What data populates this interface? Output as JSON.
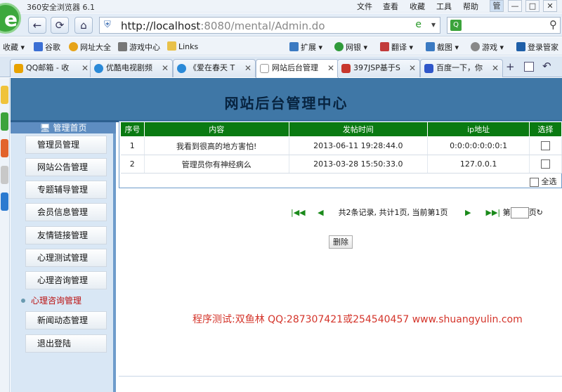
{
  "browser": {
    "title": "360安全浏览器 6.1",
    "menu": [
      "文件",
      "查看",
      "收藏",
      "工具",
      "帮助"
    ],
    "url_host": "http://localhost",
    "url_rest": ":8080/mental/Admin.do",
    "favbar": [
      "收藏",
      "谷歌",
      "网址大全",
      "游戏中心",
      "Links"
    ],
    "toolbar_right": [
      "扩展",
      "网银",
      "翻译",
      "截图",
      "游戏",
      "登录管家"
    ],
    "tabs": [
      "QQ邮箱 - 收",
      "优酷电视剧频",
      "《爱在春天 T",
      "网站后台管理",
      "397JSP基于S",
      "百度一下，你"
    ],
    "active_tab": 3
  },
  "page": {
    "title": "网站后台管理中心",
    "sidebar_head": "管理首页",
    "sidebar": [
      "管理员管理",
      "网站公告管理",
      "专题辅导管理",
      "会员信息管理",
      "友情链接管理",
      "心理测试管理",
      "心理咨询管理",
      "心理咨询管理",
      "新闻动态管理",
      "退出登陆"
    ],
    "active_sidebar": 7,
    "table": {
      "headers": [
        "序号",
        "内容",
        "发帖时间",
        "ip地址",
        "选择"
      ],
      "rows": [
        [
          "1",
          "我看到很高的地方害怕!",
          "2013-06-11 19:28:44.0",
          "0:0:0:0:0:0:0:1"
        ],
        [
          "2",
          "管理员你有神经病么",
          "2013-03-28 15:50:33.0",
          "127.0.0.1"
        ]
      ]
    },
    "select_all": "全选",
    "pager_text": "共2条记录, 共计1页, 当前第1页",
    "pager_page_prefix": "第",
    "pager_page_suffix": "页",
    "delete_button": "删除",
    "credit": "程序测试:双鱼林 QQ:287307421或254540457 www.shuangyulin.com"
  },
  "colors": {
    "banner": "#3f77a6",
    "table_header": "#0a7a12",
    "credit": "#d4342a"
  }
}
